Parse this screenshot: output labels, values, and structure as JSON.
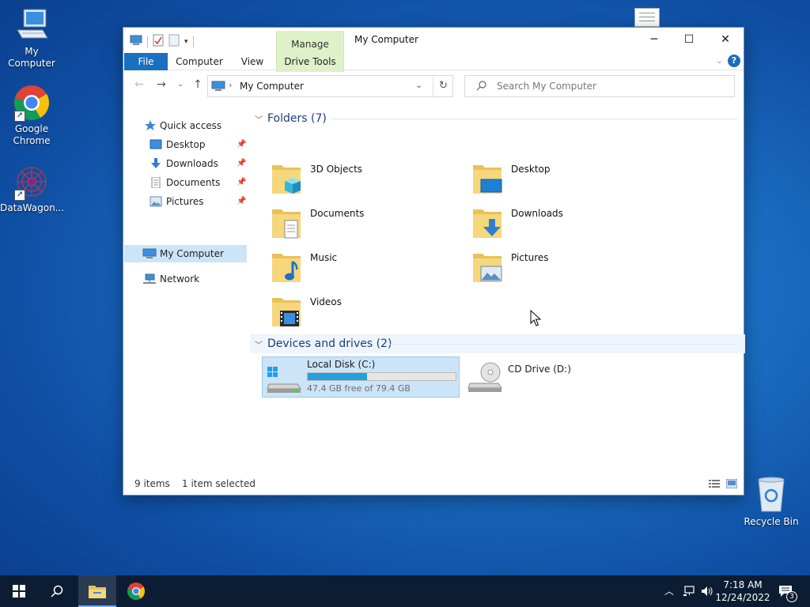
{
  "desktop": {
    "icons": [
      {
        "label": "My Computer"
      },
      {
        "label": "Google Chrome"
      },
      {
        "label": "DataWagon..."
      },
      {
        "label": "Recycle Bin"
      }
    ]
  },
  "window": {
    "title": "My Computer",
    "contextual_tab": "Manage",
    "ribbon_tabs": [
      "File",
      "Computer",
      "View",
      "Drive Tools"
    ],
    "help_label": "?",
    "address": "My Computer",
    "search_placeholder": "Search My Computer",
    "accent": "#1a6fbf"
  },
  "navpane": {
    "quick_access": "Quick access",
    "pinned": [
      "Desktop",
      "Downloads",
      "Documents",
      "Pictures"
    ],
    "this_pc": "My Computer",
    "network": "Network"
  },
  "content": {
    "folders_header": "Folders (7)",
    "folders": [
      "3D Objects",
      "Desktop",
      "Documents",
      "Downloads",
      "Music",
      "Pictures",
      "Videos"
    ],
    "devices_header": "Devices and drives (2)",
    "drives": [
      {
        "name": "Local Disk (C:)",
        "free": "47.4 GB free of 79.4 GB",
        "used_fraction": 0.403
      },
      {
        "name": "CD Drive (D:)"
      }
    ]
  },
  "status": {
    "items": "9 items",
    "selected": "1 item selected"
  },
  "taskbar": {
    "time": "7:18 AM",
    "date": "12/24/2022",
    "notifications": "3"
  }
}
